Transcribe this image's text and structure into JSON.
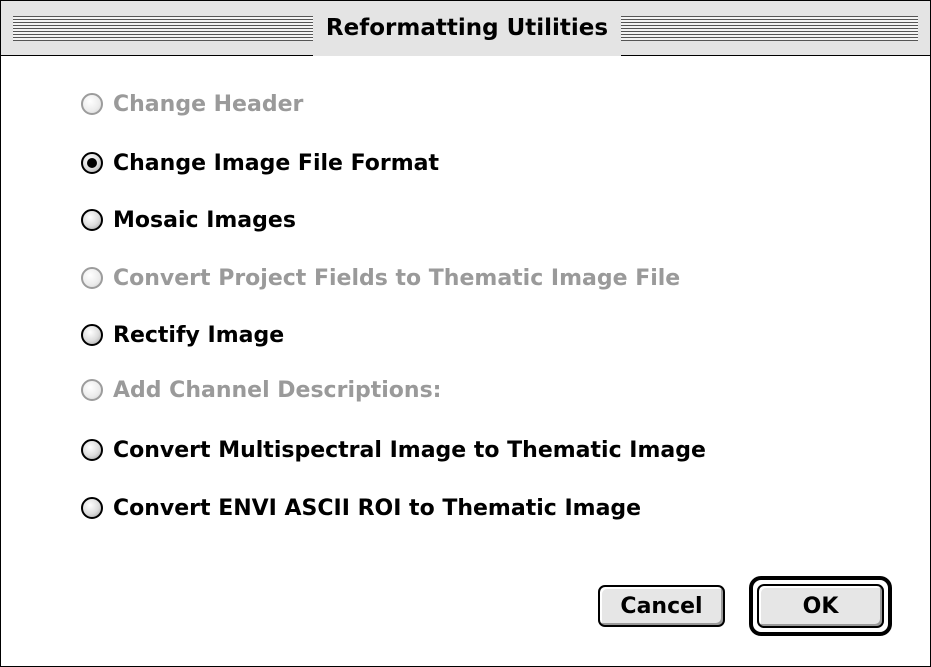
{
  "window": {
    "title": "Reformatting Utilities"
  },
  "options": [
    {
      "label": "Change Header",
      "enabled": false,
      "selected": false
    },
    {
      "label": "Change Image File Format",
      "enabled": true,
      "selected": true
    },
    {
      "label": "Mosaic Images",
      "enabled": true,
      "selected": false
    },
    {
      "label": "Convert Project Fields to Thematic Image File",
      "enabled": false,
      "selected": false
    },
    {
      "label": "Rectify Image",
      "enabled": true,
      "selected": false
    },
    {
      "label": "Add Channel Descriptions:",
      "enabled": false,
      "selected": false
    },
    {
      "label": "Convert Multispectral Image to Thematic Image",
      "enabled": true,
      "selected": false
    },
    {
      "label": "Convert ENVI ASCII ROI to Thematic Image",
      "enabled": true,
      "selected": false
    }
  ],
  "buttons": {
    "cancel": "Cancel",
    "ok": "OK"
  },
  "colors": {
    "disabled_text": "#9a9a9a",
    "enabled_text": "#000000",
    "titlebar_bg": "#e4e4e4"
  }
}
